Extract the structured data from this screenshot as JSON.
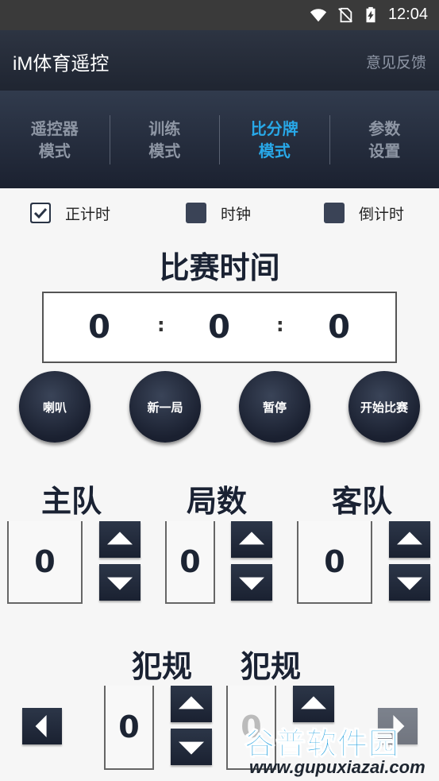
{
  "status_bar": {
    "time": "12:04",
    "icons": [
      "wifi-icon",
      "no-sim-icon",
      "battery-charging-icon"
    ]
  },
  "app_bar": {
    "title": "iM体育遥控",
    "feedback": "意见反馈"
  },
  "tabs": [
    {
      "line1": "遥控器",
      "line2": "模式"
    },
    {
      "line1": "训练",
      "line2": "模式"
    },
    {
      "line1": "比分牌",
      "line2": "模式",
      "active": true
    },
    {
      "line1": "参数",
      "line2": "设置"
    }
  ],
  "modes": [
    {
      "label": "正计时",
      "checked": true
    },
    {
      "label": "时钟",
      "checked": false
    },
    {
      "label": "倒计时",
      "checked": false
    }
  ],
  "match_time": {
    "title": "比赛时间",
    "hours": "0",
    "minutes": "0",
    "seconds": "0",
    "sep": ":"
  },
  "buttons": {
    "horn": "喇叭",
    "new_round": "新一局",
    "pause": "暂停",
    "start": "开始比赛"
  },
  "score": {
    "home_label": "主队",
    "home_value": "0",
    "rounds_label": "局数",
    "rounds_value": "0",
    "away_label": "客队",
    "away_value": "0"
  },
  "fouls": {
    "label1": "犯规",
    "label2": "犯规",
    "value1": "0",
    "value2": "0"
  },
  "watermark": {
    "cn": "谷普软件园",
    "url": "www.gupuxiazai.com"
  },
  "colors": {
    "accent": "#28a8e8",
    "dark": "#1f2531",
    "button": "#2a3446"
  }
}
